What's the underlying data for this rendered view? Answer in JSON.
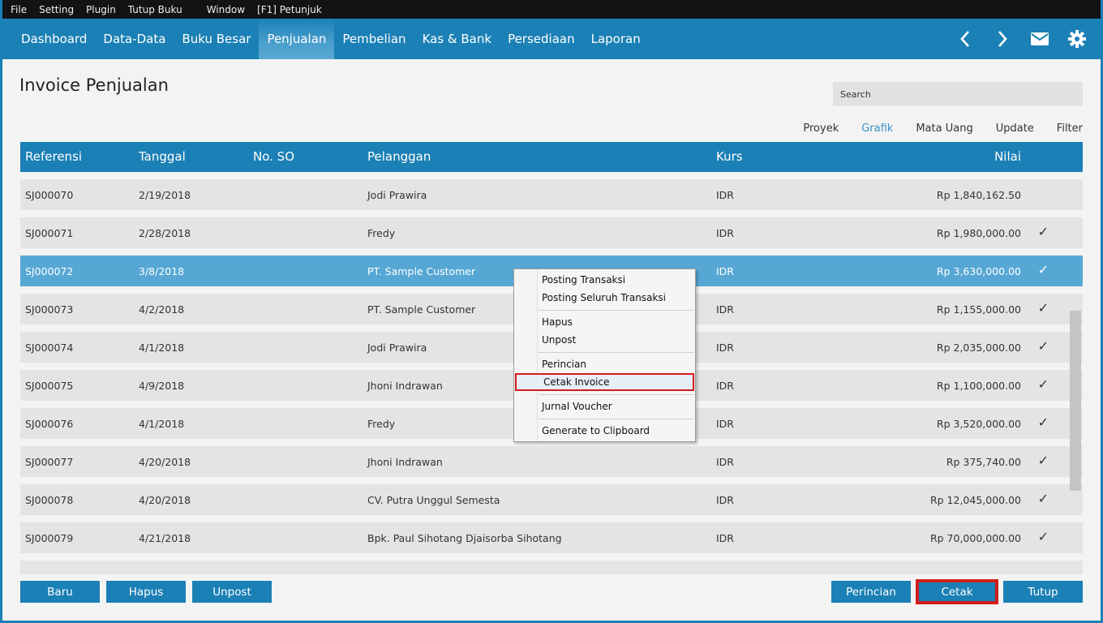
{
  "menubar": [
    "File",
    "Setting",
    "Plugin",
    "Tutup Buku",
    "Window",
    "[F1] Petunjuk"
  ],
  "nav": {
    "items": [
      "Dashboard",
      "Data-Data",
      "Buku Besar",
      "Penjualan",
      "Pembelian",
      "Kas & Bank",
      "Persediaan",
      "Laporan"
    ],
    "active": "Penjualan",
    "icons": [
      "chevron-left-icon",
      "chevron-right-icon",
      "envelope-icon",
      "gear-icon"
    ]
  },
  "page": {
    "title": "Invoice Penjualan",
    "search_placeholder": "Search"
  },
  "toolbar": [
    "Proyek",
    "Grafik",
    "Mata Uang",
    "Update",
    "Filter"
  ],
  "toolbar_active": "Grafik",
  "table": {
    "columns": [
      "Referensi",
      "Tanggal",
      "No. SO",
      "Pelanggan",
      "Kurs",
      "Nilai"
    ],
    "rows": [
      {
        "ref": "SJ000070",
        "date": "2/19/2018",
        "so": "",
        "customer": "Jodi Prawira",
        "kurs": "IDR",
        "nilai": "Rp 1,840,162.50",
        "check": ""
      },
      {
        "ref": "SJ000071",
        "date": "2/28/2018",
        "so": "",
        "customer": "Fredy",
        "kurs": "IDR",
        "nilai": "Rp 1,980,000.00",
        "check": "✓"
      },
      {
        "ref": "SJ000072",
        "date": "3/8/2018",
        "so": "",
        "customer": "PT. Sample Customer",
        "kurs": "IDR",
        "nilai": "Rp 3,630,000.00",
        "check": "✓"
      },
      {
        "ref": "SJ000073",
        "date": "4/2/2018",
        "so": "",
        "customer": "PT. Sample Customer",
        "kurs": "IDR",
        "nilai": "Rp 1,155,000.00",
        "check": "✓"
      },
      {
        "ref": "SJ000074",
        "date": "4/1/2018",
        "so": "",
        "customer": "Jodi Prawira",
        "kurs": "IDR",
        "nilai": "Rp 2,035,000.00",
        "check": "✓"
      },
      {
        "ref": "SJ000075",
        "date": "4/9/2018",
        "so": "",
        "customer": "Jhoni Indrawan",
        "kurs": "IDR",
        "nilai": "Rp 1,100,000.00",
        "check": "✓"
      },
      {
        "ref": "SJ000076",
        "date": "4/1/2018",
        "so": "",
        "customer": "Fredy",
        "kurs": "IDR",
        "nilai": "Rp 3,520,000.00",
        "check": "✓"
      },
      {
        "ref": "SJ000077",
        "date": "4/20/2018",
        "so": "",
        "customer": "Jhoni Indrawan",
        "kurs": "IDR",
        "nilai": "Rp 375,740.00",
        "check": "✓"
      },
      {
        "ref": "SJ000078",
        "date": "4/20/2018",
        "so": "",
        "customer": "CV. Putra Unggul Semesta",
        "kurs": "IDR",
        "nilai": "Rp 12,045,000.00",
        "check": "✓"
      },
      {
        "ref": "SJ000079",
        "date": "4/21/2018",
        "so": "",
        "customer": "Bpk. Paul Sihotang Djaisorba Sihotang",
        "kurs": "IDR",
        "nilai": "Rp 70,000,000.00",
        "check": "✓"
      }
    ],
    "selected_ref": "SJ000072"
  },
  "context_menu": {
    "items": [
      "Posting Transaksi",
      "Posting Seluruh Transaksi",
      "Hapus",
      "Unpost",
      "Perincian",
      "Cetak Invoice",
      "Jurnal Voucher",
      "Generate to Clipboard"
    ],
    "highlighted": "Cetak Invoice"
  },
  "buttons": {
    "baru": "Baru",
    "hapus": "Hapus",
    "unpost": "Unpost",
    "perincian": "Perincian",
    "cetak": "Cetak",
    "tutup": "Tutup"
  },
  "colors": {
    "primary": "#1b80b5",
    "selected_row": "#56a7d4",
    "row": "#e4e4e4",
    "highlight_border": "#d11c1c"
  }
}
